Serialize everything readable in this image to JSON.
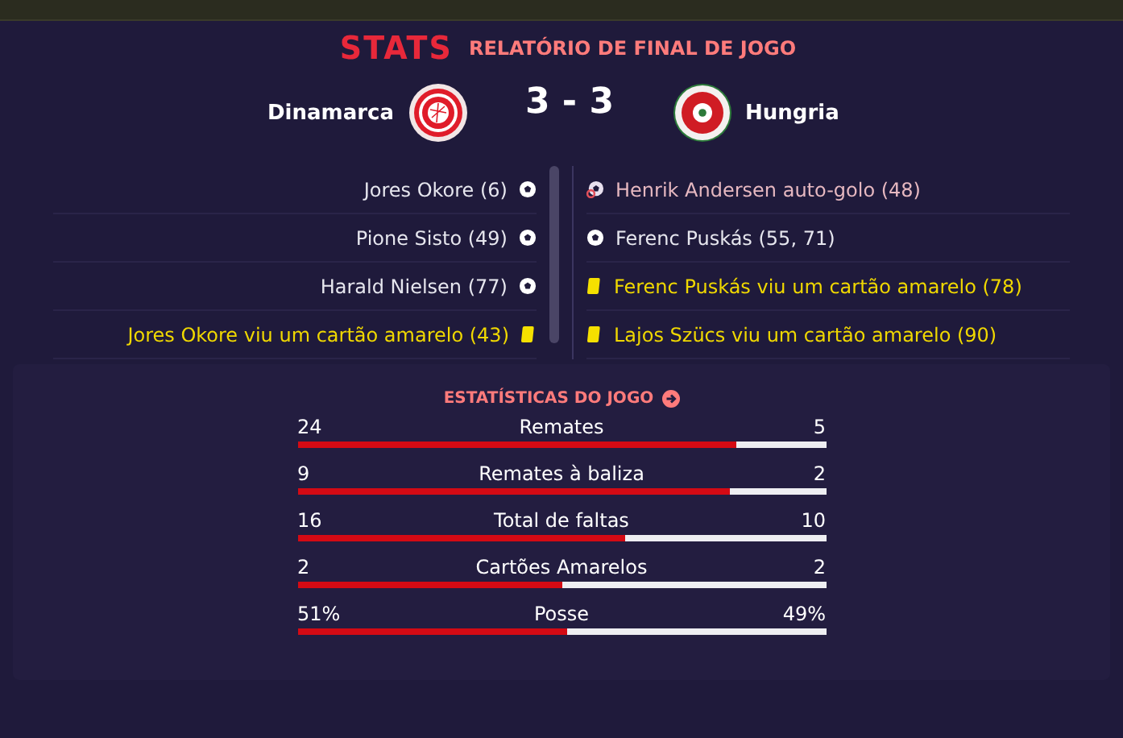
{
  "header": {
    "logo": "STATS",
    "title": "RELATÓRIO DE FINAL DE JOGO"
  },
  "match": {
    "home": "Dinamarca",
    "score": "3 - 3",
    "away": "Hungria"
  },
  "home_events": [
    {
      "kind": "goal",
      "text": "Jores Okore (6)"
    },
    {
      "kind": "goal",
      "text": "Pione Sisto (49)"
    },
    {
      "kind": "goal",
      "text": "Harald Nielsen (77)"
    },
    {
      "kind": "yellow_card",
      "text": "Jores Okore viu um cartão amarelo (43)"
    }
  ],
  "away_events": [
    {
      "kind": "own_goal",
      "text": "Henrik Andersen auto-golo (48)"
    },
    {
      "kind": "goal",
      "text": "Ferenc Puskás (55, 71)"
    },
    {
      "kind": "yellow_card",
      "text": "Ferenc Puskás viu um cartão amarelo (78)"
    },
    {
      "kind": "yellow_card",
      "text": "Lajos Szücs viu um cartão amarelo (90)"
    }
  ],
  "stats": {
    "title": "ESTATÍSTICAS DO JOGO",
    "rows": [
      {
        "label": "Remates",
        "home": "24",
        "away": "5",
        "level": 0.83
      },
      {
        "label": "Remates à baliza",
        "home": "9",
        "away": "2",
        "level": 0.82
      },
      {
        "label": "Total de faltas",
        "home": "16",
        "away": "10",
        "level": 0.62
      },
      {
        "label": "Cartões Amarelos",
        "home": "2",
        "away": "2",
        "level": 0.5
      },
      {
        "label": "Posse",
        "home": "51%",
        "away": "49%",
        "level": 0.51
      }
    ]
  }
}
